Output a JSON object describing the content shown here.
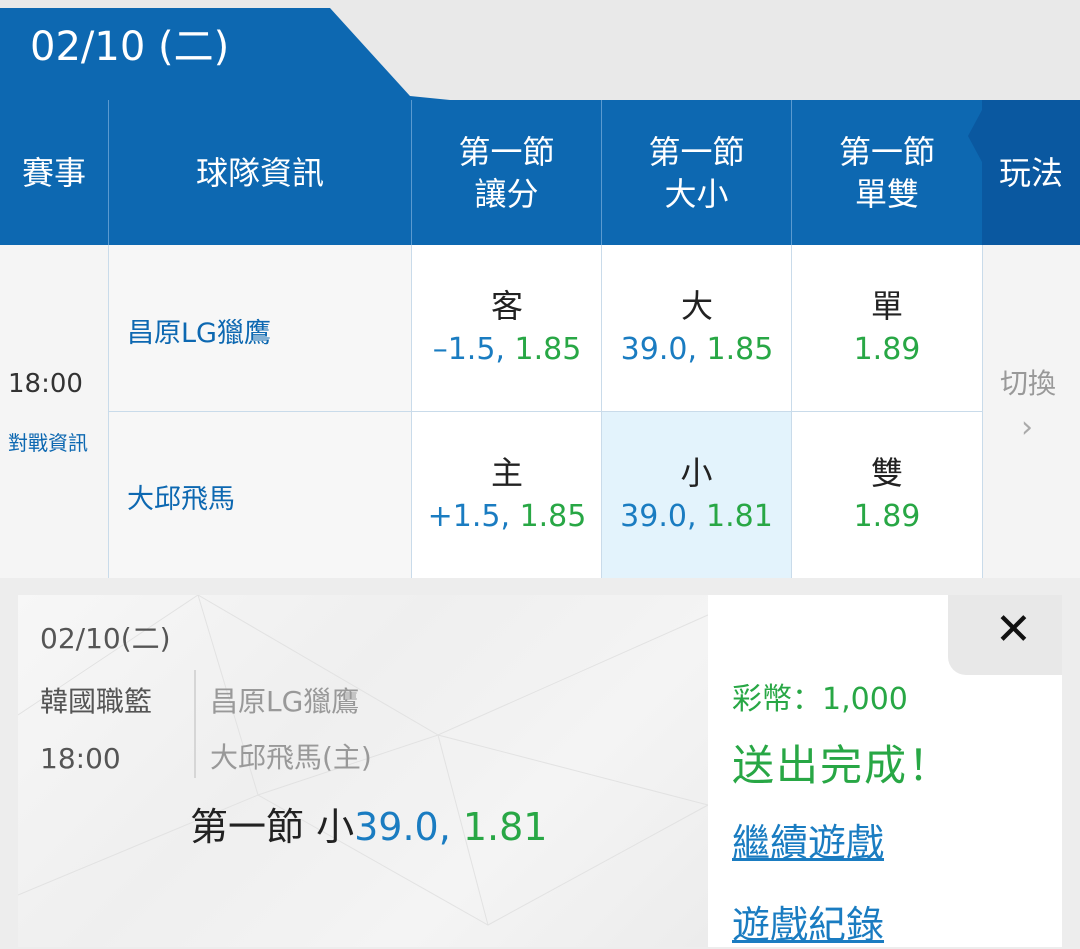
{
  "date_header": "02/10 (二)",
  "columns": {
    "event": "賽事",
    "team_info": "球隊資訊",
    "spread_line1": "第一節",
    "spread_line2": "讓分",
    "total_line1": "第一節",
    "total_line2": "大小",
    "oddeven_line1": "第一節",
    "oddeven_line2": "單雙",
    "play": "玩法"
  },
  "match": {
    "time": "18:00",
    "info_link": "對戰資訊",
    "away_team": "昌原LG獵鷹",
    "home_team": "大邱飛馬",
    "away_spread": {
      "label": "客",
      "line": "–1.5,",
      "odds": "1.85"
    },
    "home_spread": {
      "label": "主",
      "line": "+1.5,",
      "odds": "1.85"
    },
    "over": {
      "label": "大",
      "line": "39.0,",
      "odds": "1.85"
    },
    "under": {
      "label": "小",
      "line": "39.0,",
      "odds": "1.81"
    },
    "odd": {
      "label": "單",
      "odds": "1.89"
    },
    "even": {
      "label": "雙",
      "odds": "1.89"
    },
    "switch_label": "切換",
    "switch_arrow": "›"
  },
  "popup": {
    "date": "02/10(二)",
    "league": "韓國職籃",
    "time": "18:00",
    "team1": "昌原LG獵鷹",
    "team2": "大邱飛馬(主)",
    "bet_prefix": "第一節 小",
    "bet_line": "39.0,",
    "bet_odds": " 1.81",
    "coins": "彩幣：1,000",
    "status": "送出完成！",
    "continue_link": "繼續遊戲",
    "history_link": "遊戲紀錄",
    "close": "✕"
  },
  "colors": {
    "header_blue": "#0d68b1",
    "odds_green": "#28a745",
    "line_blue": "#1a7cc1",
    "selected_cell": "#e3f3fc"
  }
}
